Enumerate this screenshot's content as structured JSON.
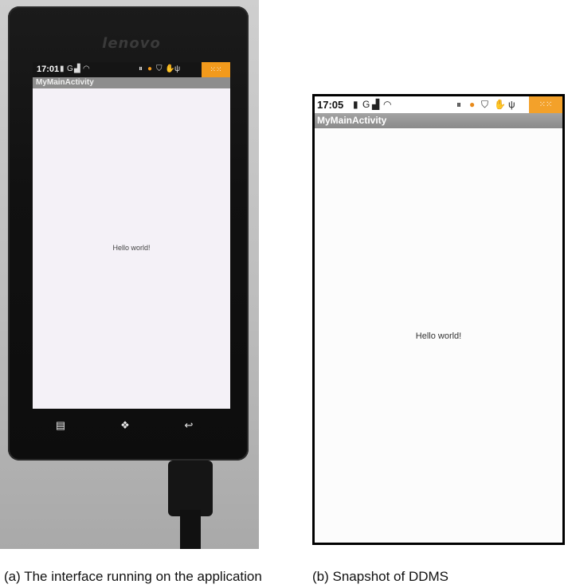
{
  "panel_a": {
    "brand": "lenovo",
    "status_bar": {
      "time": "17:01",
      "icons": [
        "sd-card-icon",
        "gps-icon",
        "signal-icon",
        "wifi-icon",
        "pause-icon",
        "circle-icon",
        "shield-icon",
        "hand-icon",
        "usb-icon",
        "notification-grid-icon"
      ]
    },
    "title_bar": "MyMainActivity",
    "content_text": "Hello world!",
    "nav_keys": [
      "menu-icon",
      "home-icon",
      "back-icon"
    ],
    "caption": "(a) The interface running on the application"
  },
  "panel_b": {
    "status_bar": {
      "time": "17:05",
      "icons": [
        "sd-card-icon",
        "gps-icon",
        "signal-icon",
        "wifi-icon",
        "pause-icon",
        "circle-icon",
        "shield-icon",
        "hand-icon",
        "usb-icon",
        "notification-grid-icon"
      ]
    },
    "title_bar": "MyMainActivity",
    "content_text": "Hello world!",
    "caption": "(b) Snapshot of DDMS"
  },
  "colors": {
    "status_orange": "#f29a1c",
    "title_bar_gray": "#8d8d8d",
    "phone_body": "#111111"
  }
}
